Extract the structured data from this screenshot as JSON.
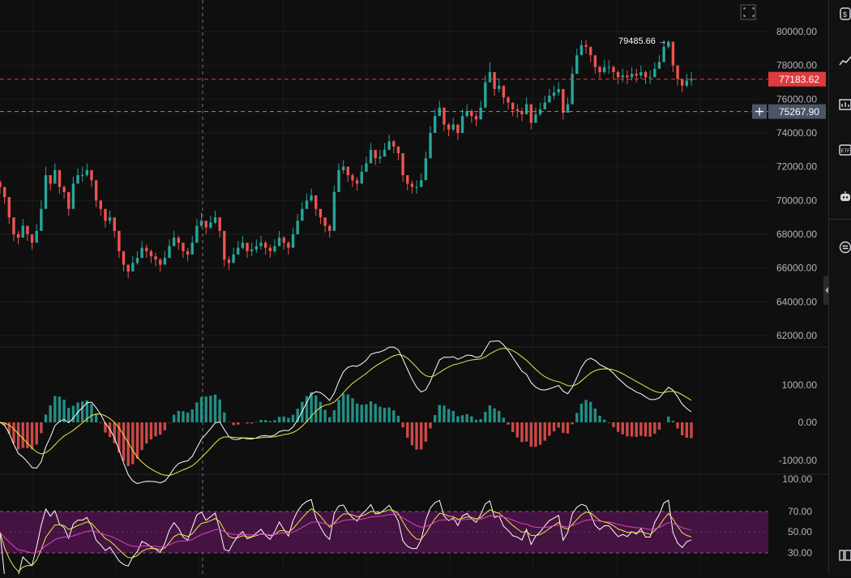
{
  "price_axis": {
    "labels": [
      "80000.00",
      "78000.00",
      "76000.00",
      "74000.00",
      "72000.00",
      "70000.00",
      "68000.00",
      "66000.00",
      "64000.00",
      "62000.00"
    ],
    "values": [
      80000,
      78000,
      76000,
      74000,
      72000,
      70000,
      68000,
      66000,
      64000,
      62000
    ]
  },
  "last_price": {
    "label": "77183.62",
    "value": 77183.62,
    "color": "#e0393e"
  },
  "crosshair_price": {
    "label": "75267.90",
    "value": 75267.9,
    "color": "#4a5568"
  },
  "high_marker": {
    "label": "79485.66 →"
  },
  "macd_axis": {
    "labels": [
      "1000.00",
      "0.00",
      "-1000.00"
    ],
    "values": [
      1000,
      0,
      -1000
    ]
  },
  "rsi_axis": {
    "labels": [
      "100.00",
      "70.00",
      "50.00",
      "30.00"
    ],
    "values": [
      100,
      70,
      50,
      30
    ]
  },
  "colors": {
    "up": "#26a69a",
    "down": "#ef5350",
    "background": "#0f0f0f",
    "rsi_band": "#4a1447",
    "rsi_line": "#ffffff",
    "rsi_ma": "#e8e84a",
    "macd_line": "#ffffff",
    "signal_line": "#e8e84a"
  },
  "toolbar_icons": [
    "dollar-icon",
    "trend-icon",
    "indicators-icon",
    "etf-icon",
    "bot-icon",
    "exchange-icon",
    "panel-icon"
  ],
  "chart_data": {
    "type": "candlestick",
    "ylim": [
      60500,
      81000
    ],
    "closes": [
      70800,
      70200,
      69000,
      68000,
      67800,
      68500,
      68000,
      67500,
      68200,
      69500,
      71500,
      71000,
      71800,
      70800,
      70500,
      69500,
      71000,
      71500,
      71500,
      71800,
      71200,
      70000,
      69500,
      68800,
      69000,
      68200,
      67000,
      66200,
      65800,
      66300,
      66600,
      67200,
      67000,
      66700,
      66500,
      66200,
      66600,
      67300,
      67800,
      67500,
      67000,
      66800,
      67500,
      68500,
      68800,
      68400,
      68700,
      69000,
      68200,
      66500,
      66300,
      66800,
      67200,
      67500,
      67000,
      67100,
      67300,
      67500,
      67200,
      67000,
      67300,
      67800,
      67500,
      67200,
      68000,
      68800,
      69500,
      70000,
      70300,
      69500,
      69000,
      68500,
      68200,
      70500,
      71800,
      72000,
      71500,
      71200,
      71000,
      71700,
      72200,
      73000,
      72500,
      72600,
      73000,
      73500,
      73200,
      72800,
      71500,
      71000,
      70800,
      70800,
      71200,
      72500,
      74000,
      75000,
      75500,
      74500,
      74200,
      74500,
      74000,
      75000,
      75300,
      75000,
      74800,
      75500,
      77000,
      77600,
      76600,
      76800,
      76100,
      75800,
      75400,
      75300,
      75100,
      75700,
      74600,
      75100,
      75400,
      75800,
      76200,
      76400,
      76600,
      75200,
      75700,
      77500,
      78600,
      79200,
      79100,
      78600,
      77900,
      77600,
      77900,
      77900,
      77600,
      77300,
      77400,
      77300,
      77500,
      77400,
      77600,
      77300,
      77300,
      77800,
      78200,
      79100,
      79400,
      78000,
      77200,
      76800,
      77100,
      77200
    ],
    "highs": [
      71200,
      70600,
      69400,
      68400,
      68200,
      68900,
      68400,
      67900,
      68600,
      70000,
      72000,
      71400,
      72200,
      71200,
      70900,
      70000,
      71400,
      71900,
      72000,
      72200,
      71600,
      70400,
      69900,
      69200,
      69400,
      68600,
      67400,
      66600,
      66200,
      66700,
      67000,
      67600,
      67400,
      67100,
      66900,
      66600,
      67000,
      67700,
      68200,
      67900,
      67400,
      67200,
      67900,
      68900,
      69300,
      68800,
      69100,
      69400,
      68600,
      66900,
      66700,
      67200,
      67600,
      67900,
      67400,
      67500,
      67700,
      67900,
      67600,
      67400,
      67700,
      68200,
      67900,
      67600,
      68400,
      69200,
      69900,
      70400,
      70700,
      69900,
      69400,
      68900,
      68600,
      70900,
      72200,
      72400,
      71900,
      71600,
      71400,
      72100,
      72600,
      73400,
      72900,
      73000,
      73400,
      73900,
      73600,
      73200,
      71900,
      71400,
      71200,
      71200,
      71600,
      72900,
      74400,
      75400,
      75900,
      74900,
      74600,
      74900,
      74400,
      75400,
      75700,
      75400,
      75200,
      75900,
      77400,
      78200,
      77000,
      77200,
      76500,
      76200,
      75800,
      75700,
      75500,
      76100,
      75000,
      75500,
      75800,
      76200,
      76600,
      76800,
      77000,
      75600,
      76100,
      77900,
      79000,
      79485,
      79500,
      79000,
      78300,
      78000,
      78300,
      78300,
      78000,
      77700,
      77800,
      77700,
      77900,
      77800,
      78000,
      77700,
      77700,
      78200,
      78600,
      79500,
      79485,
      78400,
      77600,
      77200,
      77500,
      77600
    ],
    "lows": [
      70400,
      69800,
      68600,
      67600,
      67400,
      68100,
      67600,
      67100,
      67800,
      69100,
      71100,
      70600,
      71400,
      70400,
      70100,
      69100,
      70600,
      71100,
      71100,
      71400,
      70800,
      69600,
      69100,
      68400,
      68600,
      67800,
      66600,
      65800,
      65400,
      65900,
      66200,
      66800,
      66600,
      66300,
      66100,
      65800,
      66200,
      66900,
      67400,
      67100,
      66600,
      66400,
      67100,
      68100,
      68400,
      68000,
      68300,
      68600,
      67800,
      66100,
      65900,
      66400,
      66800,
      67100,
      66600,
      66700,
      66900,
      67100,
      66800,
      66600,
      66900,
      67400,
      67100,
      66800,
      67600,
      68400,
      69100,
      69600,
      69900,
      69100,
      68600,
      68100,
      67800,
      70100,
      71400,
      71600,
      71100,
      70800,
      70600,
      71300,
      71800,
      72600,
      72100,
      72200,
      72600,
      73100,
      72800,
      72400,
      71100,
      70600,
      70400,
      70400,
      70800,
      72100,
      73600,
      74600,
      75100,
      74100,
      73800,
      74100,
      73600,
      74600,
      74900,
      74600,
      74400,
      75100,
      76600,
      77200,
      76200,
      76400,
      75700,
      75400,
      75000,
      74900,
      74700,
      75300,
      74200,
      74700,
      75000,
      75400,
      75800,
      76000,
      76200,
      74800,
      75300,
      77100,
      78200,
      78800,
      78700,
      78200,
      77500,
      77200,
      77500,
      77500,
      77200,
      76900,
      77000,
      76900,
      77100,
      77000,
      77200,
      76900,
      76900,
      77400,
      77800,
      78700,
      79000,
      77600,
      76800,
      76400,
      76700,
      76800
    ]
  }
}
